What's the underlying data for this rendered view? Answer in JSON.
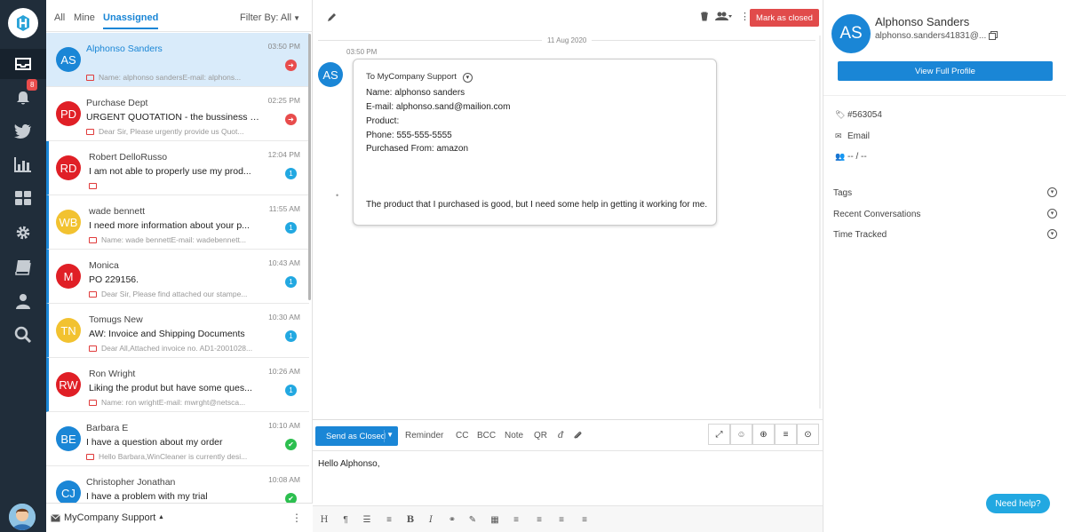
{
  "sidebar": {
    "notifications_badge": "8",
    "items": [
      {
        "icon": "inbox-icon",
        "active": true
      },
      {
        "icon": "bell-icon"
      },
      {
        "icon": "twitter-icon"
      },
      {
        "icon": "bar-chart-icon"
      },
      {
        "icon": "dashboard-grid-icon"
      },
      {
        "icon": "gear-icon"
      },
      {
        "icon": "book-icon"
      },
      {
        "icon": "user-icon"
      },
      {
        "icon": "search-icon"
      }
    ]
  },
  "list": {
    "tabs": [
      "All",
      "Mine",
      "Unassigned"
    ],
    "active_tab": "Unassigned",
    "filter_label": "Filter By: All",
    "mailbox_label": "MyCompany Support",
    "conversations": [
      {
        "initials": "AS",
        "color": "#1a86d6",
        "name": "Alphonso Sanders",
        "subject": "",
        "preview": "Name: alphonso sandersE-mail: alphons...",
        "time": "03:50 PM",
        "indicator": "reply",
        "indicator_text": "➜",
        "selected": true,
        "unread": false
      },
      {
        "initials": "PD",
        "color": "#e01f26",
        "name": "Purchase Dept",
        "subject": "URGENT QUOTATION - the bussiness c...",
        "preview": "Dear Sir,   Please urgently provide us Quot...",
        "time": "02:25 PM",
        "indicator": "reply",
        "indicator_text": "➜",
        "selected": false,
        "unread": false
      },
      {
        "initials": "RD",
        "color": "#e01f26",
        "name": "Robert DelloRusso",
        "subject": "I am not able to properly use my prod...",
        "preview": "",
        "time": "12:04 PM",
        "indicator": "count",
        "indicator_text": "1",
        "selected": false,
        "unread": true
      },
      {
        "initials": "WB",
        "color": "#f2c230",
        "name": "wade bennett",
        "subject": "I need more information about your p...",
        "preview": "Name: wade bennettE-mail: wadebennett...",
        "time": "11:55 AM",
        "indicator": "count",
        "indicator_text": "1",
        "selected": false,
        "unread": true
      },
      {
        "initials": "M",
        "color": "#e01f26",
        "name": "Monica",
        "subject": "PO 229156.",
        "preview": "Dear Sir,  Please find attached our stampe...",
        "time": "10:43 AM",
        "indicator": "count",
        "indicator_text": "1",
        "selected": false,
        "unread": true
      },
      {
        "initials": "TN",
        "color": "#f2c230",
        "name": "Tomugs New",
        "subject": "AW: Invoice and Shipping Documents",
        "preview": "Dear All,Attached invoice no. AD1-2001028...",
        "time": "10:30 AM",
        "indicator": "count",
        "indicator_text": "1",
        "selected": false,
        "unread": true
      },
      {
        "initials": "RW",
        "color": "#e01f26",
        "name": "Ron Wright",
        "subject": "Liking the produt but have some ques...",
        "preview": "Name: ron wrightE-mail: mwrght@netsca...",
        "time": "10:26 AM",
        "indicator": "count",
        "indicator_text": "1",
        "selected": false,
        "unread": true
      },
      {
        "initials": "BE",
        "color": "#1a86d6",
        "name": "Barbara E",
        "subject": "I have a question about my order",
        "preview": "Hello Barbara,WinCleaner is currently desi...",
        "time": "10:10 AM",
        "indicator": "done",
        "indicator_text": "✔",
        "selected": false,
        "unread": false
      },
      {
        "initials": "CJ",
        "color": "#1a86d6",
        "name": "Christopher Jonathan",
        "subject": "I have a problem with my trial",
        "preview": "",
        "time": "10:08 AM",
        "indicator": "done",
        "indicator_text": "✔",
        "selected": false,
        "unread": false
      }
    ]
  },
  "conversation": {
    "mark_closed_label": "Mark as closed",
    "date": "11 Aug 2020",
    "message_time": "03:50 PM",
    "sender_initials": "AS",
    "to_line": "To MyCompany Support",
    "lines": [
      "Name: alphonso sanders",
      "E-mail: alphonso.sand@mailion.com",
      "Product:",
      "Phone: 555-555-5555",
      "Purchased From: amazon"
    ],
    "body": "The product that I purchased is good, but I need some help in getting it working for me."
  },
  "composer": {
    "send_label": "Send as Closed",
    "tools": [
      "Reminder",
      "CC",
      "BCC",
      "Note",
      "QR"
    ],
    "body_text": "Hello Alphonso,"
  },
  "profile": {
    "initials": "AS",
    "name": "Alphonso Sanders",
    "email": "alphonso.sanders41831@...",
    "view_profile_label": "View Full Profile",
    "ticket_id": "#563054",
    "channel": "Email",
    "assignment": "-- / --",
    "sections": [
      "Tags",
      "Recent Conversations",
      "Time Tracked"
    ]
  },
  "help_label": "Need help?"
}
